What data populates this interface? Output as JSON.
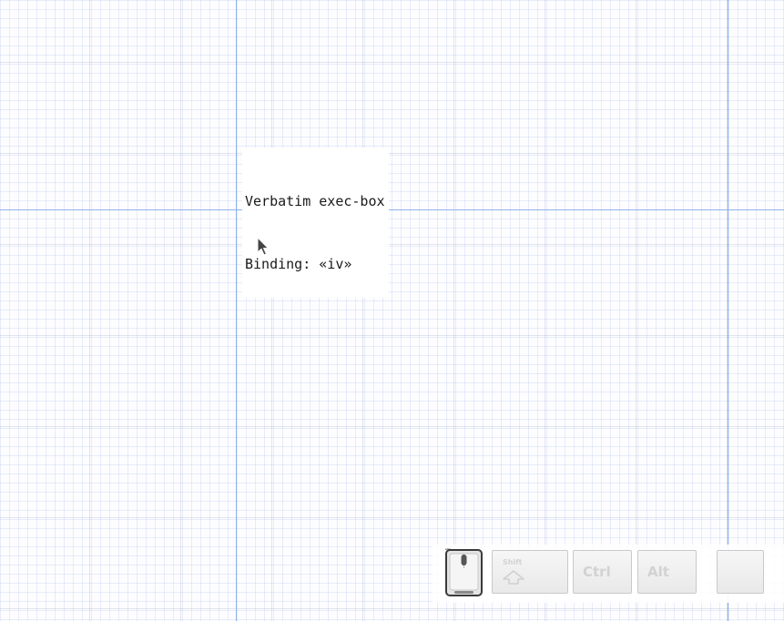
{
  "canvas": {
    "exec_box": {
      "line1": "Verbatim exec-box",
      "line2": "Binding: «iv»"
    }
  },
  "cursor": {
    "icon": "pointer-arrow-icon"
  },
  "input_overlay": {
    "mouse_icon": "mouse-icon",
    "keys": {
      "shift": "Shift",
      "ctrl": "Ctrl",
      "alt": "Alt",
      "shift_icon": "shift-arrow-icon"
    }
  },
  "colors": {
    "guide_line": "#8fb3e8",
    "grid_minor": "#e3eaf8",
    "key_text": "#d2d2d2"
  }
}
